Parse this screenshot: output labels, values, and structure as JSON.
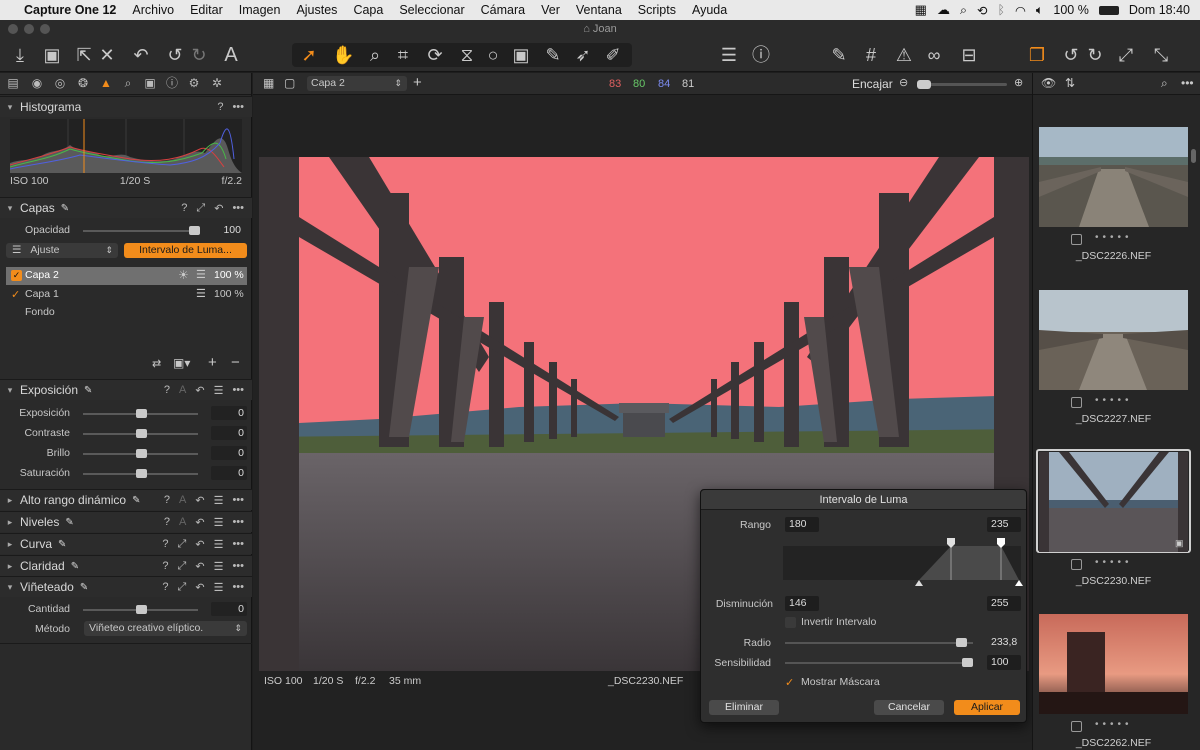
{
  "menubar": {
    "apple": "",
    "items": [
      "Capture One 12",
      "Archivo",
      "Editar",
      "Imagen",
      "Ajustes",
      "Capa",
      "Seleccionar",
      "Cámara",
      "Ver",
      "Ventana",
      "Scripts",
      "Ayuda"
    ],
    "battery": "100 %",
    "clock": "Dom 18:40"
  },
  "window": {
    "title": "Joan"
  },
  "left_panel": {
    "histogram": {
      "title": "Histograma",
      "iso": "ISO 100",
      "shutter": "1/20 S",
      "aperture": "f/2.2"
    },
    "layers": {
      "title": "Capas",
      "opacity_label": "Opacidad",
      "opacity_value": "100",
      "opacity_level": 1.0,
      "adjust_label": "Ajuste",
      "luma_button": "Intervalo de Luma...",
      "items": [
        {
          "name": "Capa 2",
          "value": "100 %",
          "checked": true,
          "selected": true
        },
        {
          "name": "Capa 1",
          "value": "100 %",
          "checked": true,
          "selected": false
        },
        {
          "name": "Fondo",
          "value": "",
          "checked": false,
          "selected": false
        }
      ]
    },
    "exposure": {
      "title": "Exposición",
      "rows": [
        {
          "label": "Exposición",
          "value": "0"
        },
        {
          "label": "Contraste",
          "value": "0"
        },
        {
          "label": "Brillo",
          "value": "0"
        },
        {
          "label": "Saturación",
          "value": "0"
        }
      ]
    },
    "sections": [
      "Alto rango dinámico",
      "Niveles",
      "Curva",
      "Claridad"
    ],
    "vignette": {
      "title": "Viñeteado",
      "amount_label": "Cantidad",
      "amount_value": "0",
      "method_label": "Método",
      "method_value": "Viñeteo creativo elíptico."
    }
  },
  "viewer": {
    "layer_select": "Capa 2",
    "rgb": {
      "r": "83",
      "g": "80",
      "b": "84",
      "l": "81"
    },
    "fit_label": "Encajar",
    "info": {
      "iso": "ISO 100",
      "shutter": "1/20 S",
      "aperture": "f/2.2",
      "focal": "35 mm",
      "filename": "_DSC2230.NEF"
    }
  },
  "luma_dialog": {
    "title": "Intervalo de Luma",
    "range_label": "Rango",
    "range_low": "180",
    "range_high": "235",
    "falloff_label": "Disminución",
    "falloff_low": "146",
    "falloff_high": "255",
    "invert_label": "Invertir Intervalo",
    "radius_label": "Radio",
    "radius_value": "233,8",
    "sensitivity_label": "Sensibilidad",
    "sensitivity_value": "100",
    "show_mask_label": "Mostrar Máscara",
    "delete_button": "Eliminar",
    "cancel_button": "Cancelar",
    "apply_button": "Aplicar"
  },
  "browser": {
    "thumbs": [
      {
        "name": "_DSC2226.NEF",
        "selected": false
      },
      {
        "name": "_DSC2227.NEF",
        "selected": false
      },
      {
        "name": "_DSC2230.NEF",
        "selected": true
      },
      {
        "name": "_DSC2262.NEF",
        "selected": false
      }
    ]
  },
  "colors": {
    "accent": "#f28c1b",
    "mask_overlay": "#f4727a"
  }
}
